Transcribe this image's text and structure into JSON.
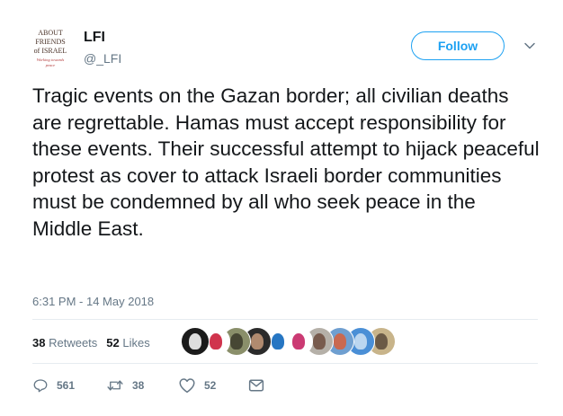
{
  "tweet": {
    "author": {
      "name": "LFI",
      "handle": "@_LFI",
      "avatar_logo_lines": [
        "ABOUT",
        "FRIENDS",
        "of ISRAEL",
        "Working towards peace"
      ]
    },
    "follow_label": "Follow",
    "text": "Tragic events on the Gazan border; all civilian deaths are regrettable. Hamas must accept responsibility for these events. Their successful attempt to hijack peaceful protest as cover to attack Israeli border communities must be condemned by all who seek peace in the Middle East.",
    "timestamp": "6:31 PM - 14 May 2018",
    "stats": {
      "retweets_count": "38",
      "retweets_label": "Retweets",
      "likes_count": "52",
      "likes_label": "Likes"
    },
    "liker_avatars": [
      {
        "name": "facts-avatar",
        "bg": "#1b1b1b",
        "accent": "#ffffff"
      },
      {
        "name": "red-devil-avatar",
        "bg": "#ffffff",
        "accent": "#c8102e"
      },
      {
        "name": "portrait-avatar-1",
        "bg": "#8a8f6a",
        "accent": "#3b3b2a"
      },
      {
        "name": "portrait-avatar-2",
        "bg": "#2b2b2b",
        "accent": "#c89b7b"
      },
      {
        "name": "i-love-nhs-avatar",
        "bg": "#ffffff",
        "accent": "#005eb8"
      },
      {
        "name": "heels-avatar",
        "bg": "#ffffff",
        "accent": "#c2185b"
      },
      {
        "name": "portrait-avatar-3",
        "bg": "#b5b0a8",
        "accent": "#6d4c3d"
      },
      {
        "name": "landscape-avatar",
        "bg": "#6f9fd0",
        "accent": "#d95f3a"
      },
      {
        "name": "blue-circle-avatar",
        "bg": "#4a8fd6",
        "accent": "#cfe3f5"
      },
      {
        "name": "portrait-avatar-4",
        "bg": "#c8b48a",
        "accent": "#5a4a3a"
      }
    ],
    "actions": {
      "replies": "561",
      "retweets": "38",
      "likes": "52"
    },
    "colors": {
      "accent": "#1da1f2",
      "text": "#14171a",
      "secondary": "#657786",
      "divider": "#e6ecf0"
    }
  }
}
